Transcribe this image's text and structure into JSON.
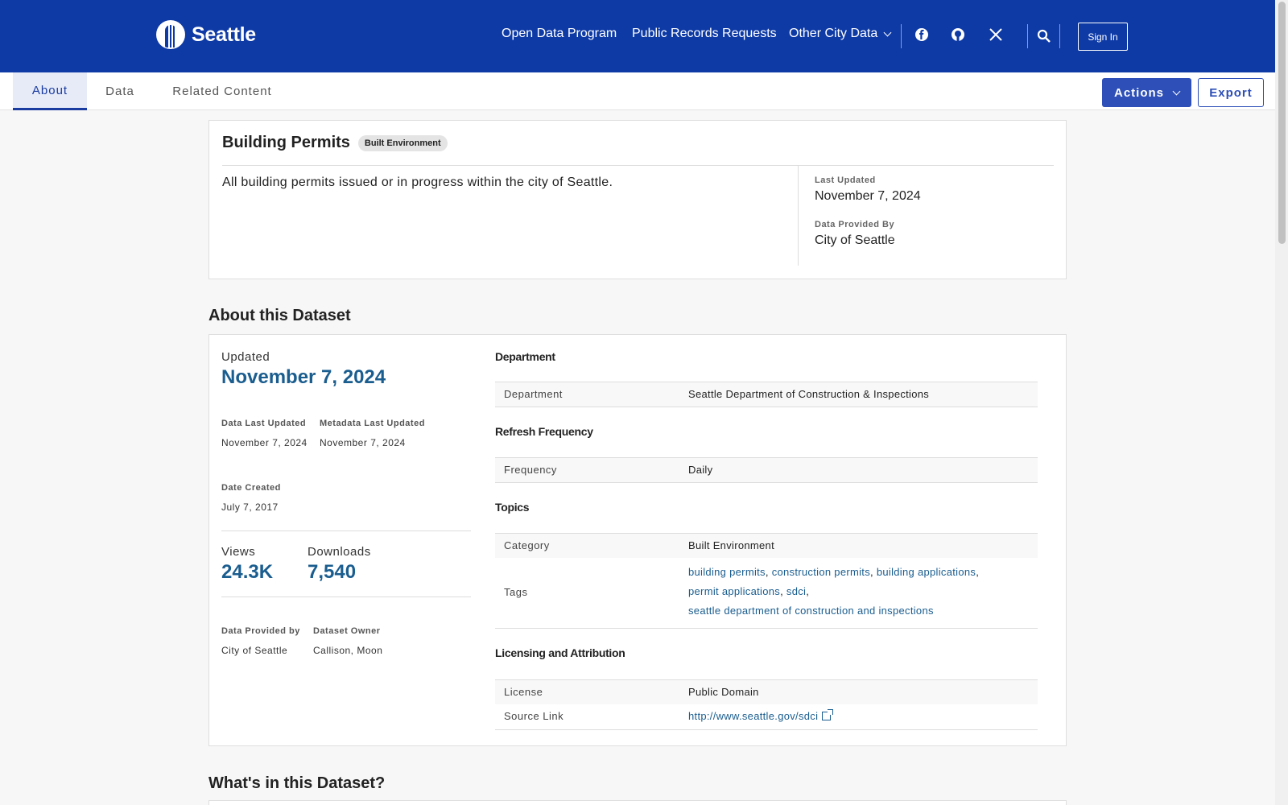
{
  "header": {
    "logo_text": "Seattle",
    "nav": [
      "Open Data Program",
      "Public Records Requests",
      "Other City Data"
    ],
    "signin": "Sign In"
  },
  "tabs": [
    "About",
    "Data",
    "Related Content"
  ],
  "toolbar": {
    "actions": "Actions",
    "export": "Export"
  },
  "dataset": {
    "title": "Building Permits",
    "category_badge": "Built Environment",
    "description": "All building permits issued or in progress within the city of Seattle.",
    "last_updated_label": "Last Updated",
    "last_updated": "November 7, 2024",
    "provided_by_label": "Data Provided By",
    "provided_by": "City of Seattle"
  },
  "about": {
    "heading": "About this Dataset",
    "updated_label": "Updated",
    "updated": "November 7, 2024",
    "data_last_updated_label": "Data Last Updated",
    "data_last_updated": "November 7, 2024",
    "metadata_last_updated_label": "Metadata Last Updated",
    "metadata_last_updated": "November 7, 2024",
    "date_created_label": "Date Created",
    "date_created": "July 7, 2017",
    "views_label": "Views",
    "views": "24.3K",
    "downloads_label": "Downloads",
    "downloads": "7,540",
    "provided_by_label": "Data Provided by",
    "provided_by": "City of Seattle",
    "owner_label": "Dataset Owner",
    "owner": "Callison, Moon",
    "sections": {
      "department_head": "Department",
      "department_key": "Department",
      "department_val": "Seattle Department of Construction & Inspections",
      "refresh_head": "Refresh Frequency",
      "frequency_key": "Frequency",
      "frequency_val": "Daily",
      "topics_head": "Topics",
      "category_key": "Category",
      "category_val": "Built Environment",
      "tags_key": "Tags",
      "tags": [
        "building permits",
        "construction permits",
        "building applications",
        "permit applications",
        "sdci",
        "seattle department of construction and inspections"
      ],
      "licensing_head": "Licensing and Attribution",
      "license_key": "License",
      "license_val": "Public Domain",
      "source_key": "Source Link",
      "source_val": "http://www.seattle.gov/sdci"
    }
  },
  "whats_in": {
    "heading": "What's in this Dataset?"
  }
}
